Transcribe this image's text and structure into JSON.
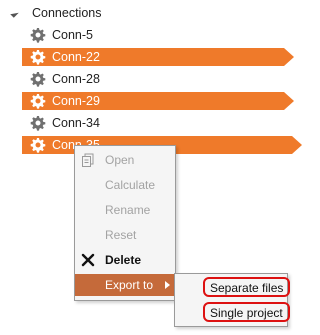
{
  "tree": {
    "root_label": "Connections",
    "items": [
      {
        "label": "Conn-5",
        "selected": false
      },
      {
        "label": "Conn-22",
        "selected": true
      },
      {
        "label": "Conn-28",
        "selected": false
      },
      {
        "label": "Conn-29",
        "selected": true
      },
      {
        "label": "Conn-34",
        "selected": false
      },
      {
        "label": "Conn-35",
        "selected": true
      }
    ],
    "selection_color": "#ef7a2a"
  },
  "context_menu": {
    "items": [
      {
        "label": "Open",
        "icon": "document-icon",
        "enabled": false
      },
      {
        "label": "Calculate",
        "icon": "",
        "enabled": false
      },
      {
        "label": "Rename",
        "icon": "",
        "enabled": false
      },
      {
        "label": "Reset",
        "icon": "",
        "enabled": false
      },
      {
        "label": "Delete",
        "icon": "close-icon",
        "enabled": true
      },
      {
        "label": "Export to",
        "icon": "",
        "enabled": true,
        "has_submenu": true,
        "highlighted": true
      }
    ],
    "highlight_color": "#c56a3a"
  },
  "export_submenu": {
    "items": [
      {
        "label": "Separate files"
      },
      {
        "label": "Single project"
      }
    ],
    "annotation_color": "#dd1111"
  }
}
